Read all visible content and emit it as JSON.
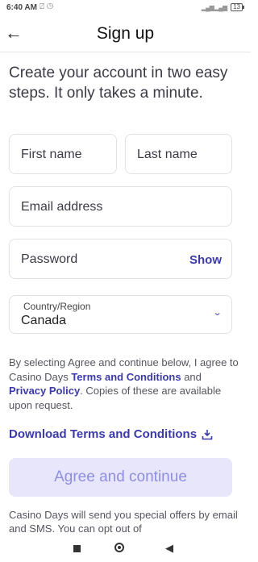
{
  "status": {
    "time": "6:40 AM",
    "icons": "⍁ ◷",
    "battery": "13"
  },
  "appbar": {
    "back": "←",
    "title": "Sign up"
  },
  "intro": "Create your account in two easy steps. It only takes a minute.",
  "form": {
    "first_name_placeholder": "First name",
    "last_name_placeholder": "Last name",
    "email_placeholder": "Email address",
    "password_placeholder": "Password",
    "show_label": "Show",
    "country_label": "Country/Region",
    "country_value": "Canada",
    "chevron": "⌄"
  },
  "terms": {
    "prefix": "By selecting Agree and continue below, I agree to Casino Days ",
    "terms_link": "Terms and Conditions",
    "and": " and ",
    "privacy_link": "Privacy Policy",
    "suffix": ". Copies of these are available upon request."
  },
  "download": {
    "label": "Download Terms and Conditions",
    "icon": "download-icon"
  },
  "agree_button": "Agree and continue",
  "offers": "Casino Days will send you special offers by email and SMS. You can opt out of",
  "colors": {
    "accent": "#3b3aa8",
    "button_bg": "#e8e6fb",
    "button_text": "#8f8ee0"
  }
}
